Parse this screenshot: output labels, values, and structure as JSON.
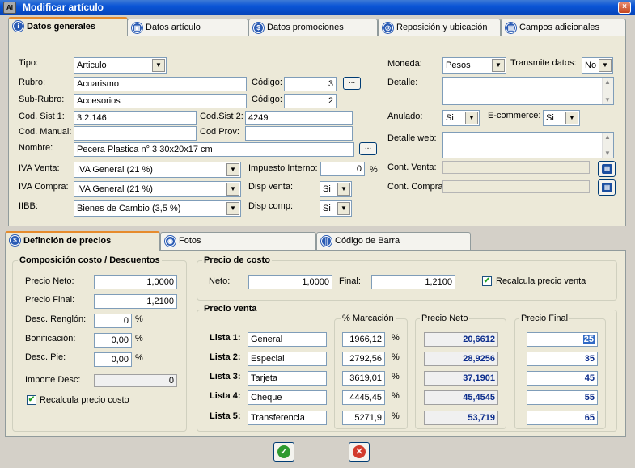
{
  "window": {
    "title": "Modificar artículo",
    "close": "×"
  },
  "tabs_top": [
    {
      "label": "Datos generales"
    },
    {
      "label": "Datos artículo"
    },
    {
      "label": "Datos promociones"
    },
    {
      "label": "Reposición y ubicación"
    },
    {
      "label": "Campos adicionales"
    }
  ],
  "general": {
    "tipo_label": "Tipo:",
    "tipo_value": "Articulo",
    "rubro_label": "Rubro:",
    "rubro_value": "Acuarismo",
    "rubro_codigo_label": "Código:",
    "rubro_codigo_value": "3",
    "subrubro_label": "Sub-Rubro:",
    "subrubro_value": "Accesorios",
    "subrubro_codigo_label": "Código:",
    "subrubro_codigo_value": "2",
    "codsist1_label": "Cod. Sist 1:",
    "codsist1_value": "3.2.146",
    "codsist2_label": "Cod.Sist 2:",
    "codsist2_value": "4249",
    "codmanual_label": "Cod. Manual:",
    "codmanual_value": "",
    "codprov_label": "Cod Prov:",
    "codprov_value": "",
    "nombre_label": "Nombre:",
    "nombre_value": "Pecera Plastica n° 3 30x20x17 cm",
    "ivaventa_label": "IVA Venta:",
    "ivaventa_value": "IVA General (21 %)",
    "ivacompra_label": "IVA Compra:",
    "ivacompra_value": "IVA General (21 %)",
    "iibb_label": "IIBB:",
    "iibb_value": "Bienes de Cambio (3,5 %)",
    "impuesto_label": "Impuesto Interno:",
    "impuesto_value": "0",
    "impuesto_unit": "%",
    "dispventa_label": "Disp venta:",
    "dispventa_value": "Si",
    "dispcomp_label": "Disp comp:",
    "dispcomp_value": "Si",
    "moneda_label": "Moneda:",
    "moneda_value": "Pesos",
    "transmite_label": "Transmite datos:",
    "transmite_value": "No",
    "detalle_label": "Detalle:",
    "anulado_label": "Anulado:",
    "anulado_value": "Si",
    "ecommerce_label": "E-commerce:",
    "ecommerce_value": "Si",
    "detalleweb_label": "Detalle web:",
    "contventa_label": "Cont. Venta:",
    "contcompra_label": "Cont. Compra:",
    "dots": "..."
  },
  "tabs_bottom": [
    {
      "label": "Definción de precios"
    },
    {
      "label": "Fotos"
    },
    {
      "label": "Código de Barra"
    }
  ],
  "composicion": {
    "title": "Composición costo / Descuentos",
    "neto_label": "Precio Neto:",
    "neto_value": "1,0000",
    "final_label": "Precio Final:",
    "final_value": "1,2100",
    "renglon_label": "Desc. Renglón:",
    "renglon_value": "0",
    "bonif_label": "Bonificación:",
    "bonif_value": "0,00",
    "pie_label": "Desc. Pie:",
    "pie_value": "0,00",
    "importe_label": "Importe Desc:",
    "importe_value": "0",
    "pct": "%",
    "recalcula_label": "Recalcula precio costo"
  },
  "costo": {
    "title": "Precio de costo",
    "neto_label": "Neto:",
    "neto_value": "1,0000",
    "final_label": "Final:",
    "final_value": "1,2100",
    "recalcula_label": "Recalcula precio venta"
  },
  "venta": {
    "title": "Precio venta",
    "marcacion_header": "% Marcación",
    "neto_header": "Precio Neto",
    "final_header": "Precio Final",
    "pct": "%",
    "rows": [
      {
        "label": "Lista 1:",
        "name": "General",
        "marcacion": "1966,12",
        "neto": "20,6612",
        "final": "25"
      },
      {
        "label": "Lista 2:",
        "name": "Especial",
        "marcacion": "2792,56",
        "neto": "28,9256",
        "final": "35"
      },
      {
        "label": "Lista 3:",
        "name": "Tarjeta",
        "marcacion": "3619,01",
        "neto": "37,1901",
        "final": "45"
      },
      {
        "label": "Lista 4:",
        "name": "Cheque",
        "marcacion": "4445,45",
        "neto": "45,4545",
        "final": "55"
      },
      {
        "label": "Lista 5:",
        "name": "Transferencia",
        "marcacion": "5271,9",
        "neto": "53,719",
        "final": "65"
      }
    ]
  },
  "icons": {
    "dropdown": "▼",
    "check": "✔",
    "ok": "✓",
    "cancel": "✕",
    "scroll_up": "▲",
    "scroll_down": "▼"
  }
}
